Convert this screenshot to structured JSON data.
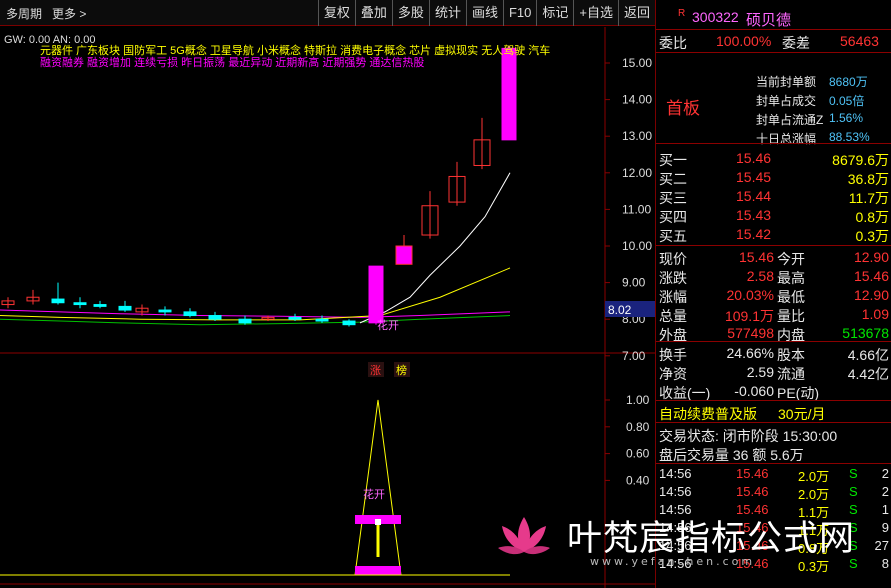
{
  "toolbar": {
    "period": "多周期",
    "more": "更多 >",
    "buttons": [
      "复权",
      "叠加",
      "多股",
      "统计",
      "画线",
      "F10",
      "标记",
      "+自选",
      "返回"
    ]
  },
  "chart": {
    "indicator_line": "GW: 0.00  AN: 0.00",
    "concepts_line1": "元器件    广东板块  国防军工 5G概念 卫星导航 小米概念 特斯拉 消费电子概念 芯片 虚拟现实 无人驾驶 汽车",
    "concepts_line2": "融资融券 融资增加 连续亏损 昨日振荡 最近异动 近期新高 近期强势 通达信热股",
    "price_axis": [
      "15.00",
      "14.00",
      "13.00",
      "12.00",
      "11.00",
      "10.00",
      "9.00",
      "8.00",
      "7.00"
    ],
    "current_price_tag": "8.02",
    "sub_axis": [
      "1.00",
      "0.80",
      "0.60",
      "0.40"
    ],
    "huakai_label": "花开",
    "sub_huakai_label": "花开",
    "zhang_label": "涨",
    "bang_label": "榜",
    "colors": {
      "up": "#ff3333",
      "down": "#00ffff",
      "magenta": "#ff00ff",
      "axis": "#8b0000",
      "ma1": "#ffffff",
      "ma2": "#ffff00",
      "ma3": "#ff00ff",
      "ma4": "#00c000"
    }
  },
  "side": {
    "code_prefix": "R",
    "code": "300322",
    "name": "硕贝德",
    "weibi_label": "委比",
    "weibi_value": "100.00%",
    "weicha_label": "委差",
    "weicha_value": "56463",
    "board": "首板",
    "seal_info": [
      {
        "label": "当前封单额",
        "value": "8680万"
      },
      {
        "label": "封单占成交",
        "value": "0.05倍"
      },
      {
        "label": "封单占流通Z",
        "value": "1.56%"
      },
      {
        "label": "十日总涨幅",
        "value": "88.53%"
      }
    ],
    "bids": [
      {
        "label": "买一",
        "price": "15.46",
        "vol": "8679.6万"
      },
      {
        "label": "买二",
        "price": "15.45",
        "vol": "36.8万"
      },
      {
        "label": "买三",
        "price": "15.44",
        "vol": "11.7万"
      },
      {
        "label": "买四",
        "price": "15.43",
        "vol": "0.8万"
      },
      {
        "label": "买五",
        "price": "15.42",
        "vol": "0.3万"
      }
    ],
    "stats": [
      {
        "l1": "现价",
        "v1": "15.46",
        "l2": "今开",
        "v2": "12.90"
      },
      {
        "l1": "涨跌",
        "v1": "2.58",
        "l2": "最高",
        "v2": "15.46"
      },
      {
        "l1": "涨幅",
        "v1": "20.03%",
        "l2": "最低",
        "v2": "12.90"
      },
      {
        "l1": "总量",
        "v1": "109.1万",
        "l2": "量比",
        "v2": "1.09"
      },
      {
        "l1": "外盘",
        "v1": "577498",
        "l2": "内盘",
        "v2": "513678"
      }
    ],
    "stats2": [
      {
        "l1": "换手",
        "v1": "24.66%",
        "l2": "股本",
        "v2": "4.66亿"
      },
      {
        "l1": "净资",
        "v1": "2.59",
        "l2": "流通",
        "v2": "4.42亿"
      },
      {
        "l1": "收益(一)",
        "v1": "-0.060",
        "l2": "PE(动)",
        "v2": ""
      }
    ],
    "ad_text": "自动续费普及版",
    "ad_price": "30元/月",
    "trade_state": "交易状态: 闭市阶段 15:30:00",
    "after_hours": "盘后交易量 36 额 5.6万",
    "ticks": [
      {
        "time": "14:56",
        "price": "15.46",
        "vol": "2.0万",
        "side": "S",
        "n": "2"
      },
      {
        "time": "14:56",
        "price": "15.46",
        "vol": "2.0万",
        "side": "S",
        "n": "2"
      },
      {
        "time": "14:56",
        "price": "15.46",
        "vol": "1.1万",
        "side": "S",
        "n": "1"
      },
      {
        "time": "14:56",
        "price": "15.46",
        "vol": "1.1万",
        "side": "S",
        "n": "9"
      },
      {
        "time": "14:56",
        "price": "15.46",
        "vol": "0.8万",
        "side": "S",
        "n": "27"
      },
      {
        "time": "14:56",
        "price": "15.46",
        "vol": "0.3万",
        "side": "S",
        "n": "8"
      }
    ]
  },
  "watermark": {
    "text": "叶梵宸指标公式网",
    "url": "www.yefanchen.com"
  }
}
